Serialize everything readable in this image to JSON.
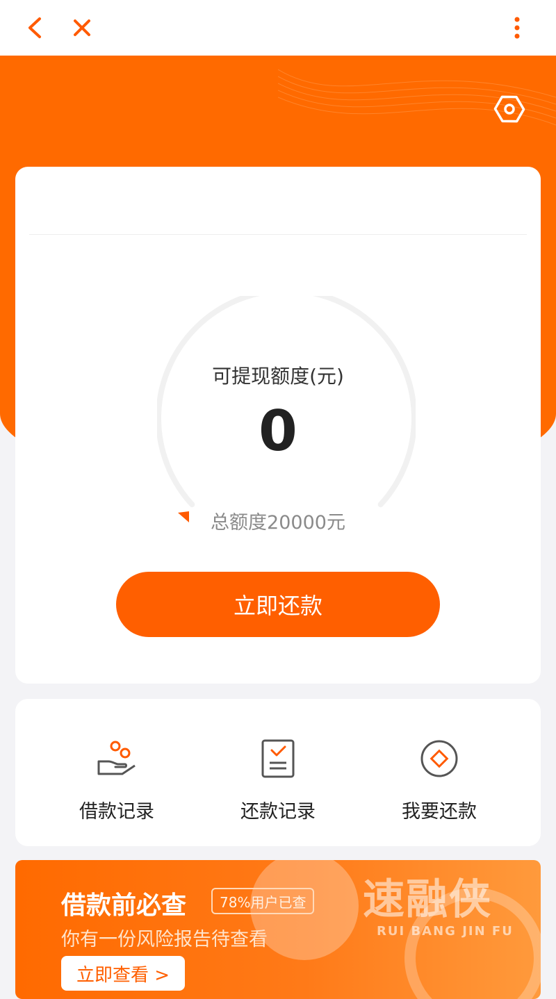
{
  "topbar": {
    "back_icon": "chevron-left-icon",
    "close_icon": "close-icon",
    "more_icon": "more-vertical-icon"
  },
  "hero": {
    "settings_icon": "settings-hex-icon"
  },
  "quota": {
    "label": "可提现额度(元)",
    "value": "0",
    "total": "总额度20000元",
    "progress_fraction": 0.0
  },
  "repay_button": {
    "label": "立即还款"
  },
  "menu": {
    "items": [
      {
        "label": "借款记录",
        "icon": "loan-record-icon"
      },
      {
        "label": "还款记录",
        "icon": "repayment-record-icon"
      },
      {
        "label": "我要还款",
        "icon": "repay-coin-icon"
      }
    ]
  },
  "banner": {
    "title": "借款前必查",
    "tag": "78%用户已查",
    "subtitle": "你有一份风险报告待查看",
    "cta": "立即查看 >",
    "watermark_cn": "速融侠",
    "watermark_en": "RUI BANG JIN FU"
  },
  "colors": {
    "accent": "#ff6a00",
    "button": "#ff5f00",
    "page_bg": "#f3f3f6"
  }
}
